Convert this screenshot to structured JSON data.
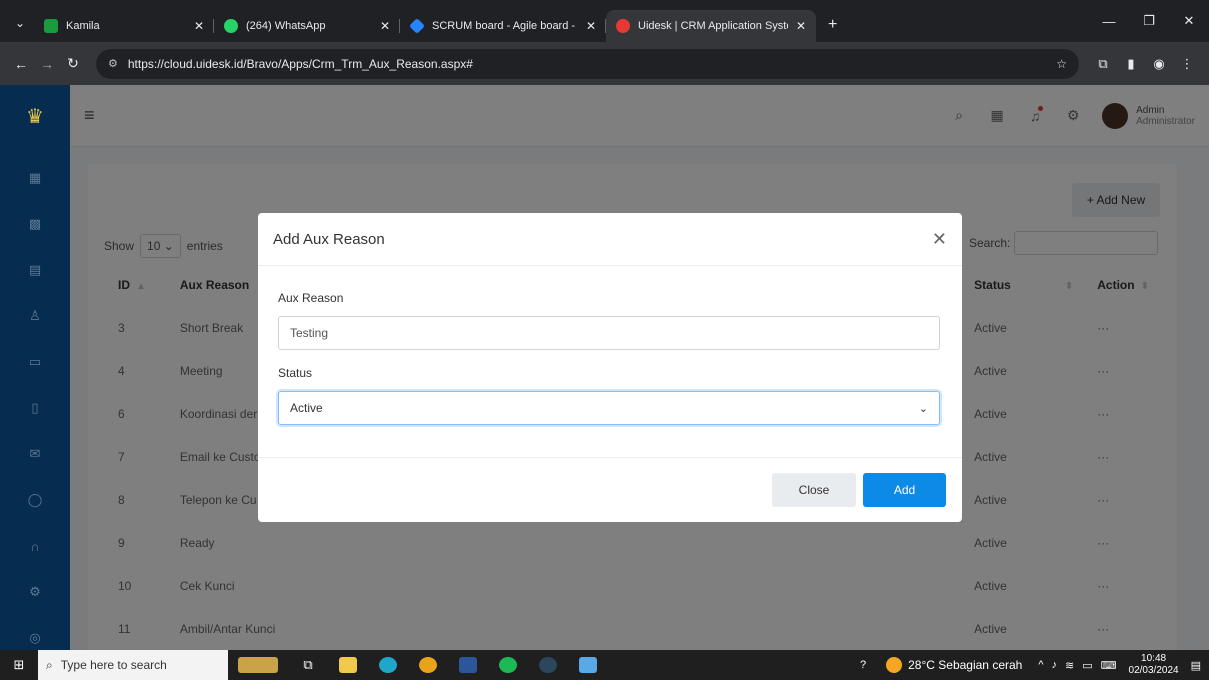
{
  "browser": {
    "tabs": [
      {
        "title": "Kamila",
        "favicon_color": "#1a9c3e",
        "active": false
      },
      {
        "title": "(264) WhatsApp",
        "favicon_color": "#25d366",
        "active": false
      },
      {
        "title": "SCRUM board - Agile board - Ji",
        "favicon_color": "#2684ff",
        "active": false
      },
      {
        "title": "Uidesk | CRM Application Syste",
        "favicon_color": "#e53935",
        "active": true
      }
    ],
    "new_tab": "+",
    "url": "https://cloud.uidesk.id/Bravo/Apps/Crm_Trm_Aux_Reason.aspx#"
  },
  "header": {
    "user_name": "Admin",
    "user_role": "Administrator"
  },
  "page": {
    "add_new_label": "+ Add New",
    "show_label": "Show",
    "entries_value": "10",
    "entries_label": "entries",
    "search_label": "Search:",
    "columns": {
      "id": "ID",
      "reason": "Aux Reason",
      "status": "Status",
      "action": "Action"
    },
    "rows": [
      {
        "id": "3",
        "reason": "Short Break",
        "status": "Active",
        "action": "···"
      },
      {
        "id": "4",
        "reason": "Meeting",
        "status": "Active",
        "action": "···"
      },
      {
        "id": "6",
        "reason": "Koordinasi der",
        "status": "Active",
        "action": "···"
      },
      {
        "id": "7",
        "reason": "Email ke Custo",
        "status": "Active",
        "action": "···"
      },
      {
        "id": "8",
        "reason": "Telepon ke Cu",
        "status": "Active",
        "action": "···"
      },
      {
        "id": "9",
        "reason": "Ready",
        "status": "Active",
        "action": "···"
      },
      {
        "id": "10",
        "reason": "Cek Kunci",
        "status": "Active",
        "action": "···"
      },
      {
        "id": "11",
        "reason": "Ambil/Antar Kunci",
        "status": "Active",
        "action": "···"
      }
    ]
  },
  "modal": {
    "title": "Add Aux Reason",
    "reason_label": "Aux Reason",
    "reason_value": "Testing",
    "status_label": "Status",
    "status_value": "Active",
    "close_label": "Close",
    "add_label": "Add"
  },
  "taskbar": {
    "search_placeholder": "Type here to search",
    "weather": "28°C  Sebagian cerah",
    "time": "10:48",
    "date": "02/03/2024"
  },
  "colors": {
    "sidebar": "#062d4f",
    "primary_button": "#0d8ae6"
  }
}
